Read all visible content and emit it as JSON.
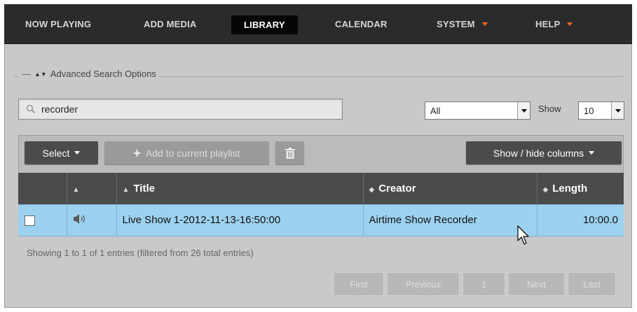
{
  "nav": {
    "items": [
      {
        "label": "NOW PLAYING"
      },
      {
        "label": "ADD MEDIA"
      },
      {
        "label": "LIBRARY"
      },
      {
        "label": "CALENDAR"
      },
      {
        "label": "SYSTEM"
      },
      {
        "label": "HELP"
      }
    ],
    "active": "LIBRARY",
    "accent_color": "#ff6b1c"
  },
  "search": {
    "legend": "Advanced Search Options",
    "query": "recorder",
    "type_filter": "All",
    "show_label": "Show",
    "page_size": "10"
  },
  "toolbar": {
    "select_label": "Select",
    "add_label": "Add to current playlist",
    "columns_label": "Show / hide columns"
  },
  "table": {
    "columns": [
      "Title",
      "Creator",
      "Length"
    ],
    "rows": [
      {
        "title": "Live Show 1-2012-11-13-16:50:00",
        "creator": "Airtime Show Recorder",
        "length": "10:00.0",
        "selected": false
      }
    ],
    "row_highlight_color": "#9cd2ef"
  },
  "footer": {
    "info": "Showing 1 to 1 of 1 entries (filtered from 26 total entries)",
    "pager": [
      "First",
      "Previous",
      "1",
      "Next",
      "Last"
    ]
  },
  "icons": [
    "search-icon",
    "plus-icon",
    "trash-icon",
    "speaker-icon",
    "sort-icon",
    "caret-down-icon",
    "mouse-pointer-icon"
  ]
}
